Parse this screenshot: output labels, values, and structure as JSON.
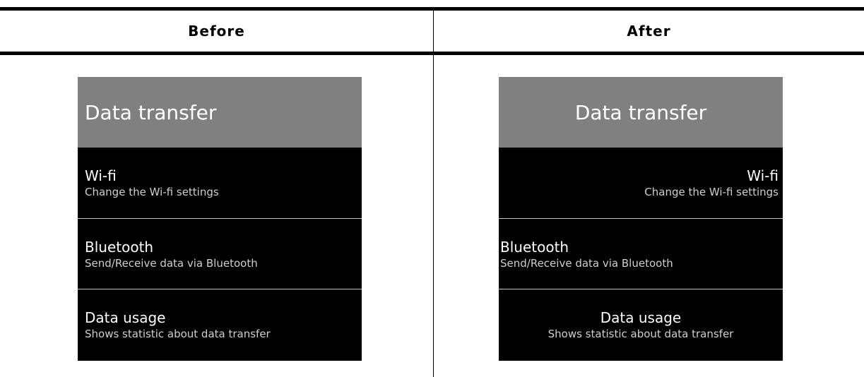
{
  "columns": {
    "before_label": "Before",
    "after_label": "After"
  },
  "before": {
    "header": "Data transfer",
    "items": [
      {
        "title": "Wi-fi",
        "subtitle": "Change the Wi-fi settings"
      },
      {
        "title": "Bluetooth",
        "subtitle": "Send/Receive data via Bluetooth"
      },
      {
        "title": "Data usage",
        "subtitle": "Shows statistic about data transfer"
      }
    ]
  },
  "after": {
    "header": "Data transfer",
    "items": [
      {
        "title": "Wi-fi",
        "subtitle": "Change the Wi-fi settings",
        "alignment": "right"
      },
      {
        "title": "Bluetooth",
        "subtitle": "Send/Receive data via Bluetooth",
        "alignment": "left"
      },
      {
        "title": "Data usage",
        "subtitle": "Shows statistic about data transfer",
        "alignment": "center"
      }
    ]
  },
  "colors": {
    "header_bg": "#808080",
    "panel_bg": "#000000",
    "separator": "#c8c8c8",
    "text": "#ffffff"
  }
}
